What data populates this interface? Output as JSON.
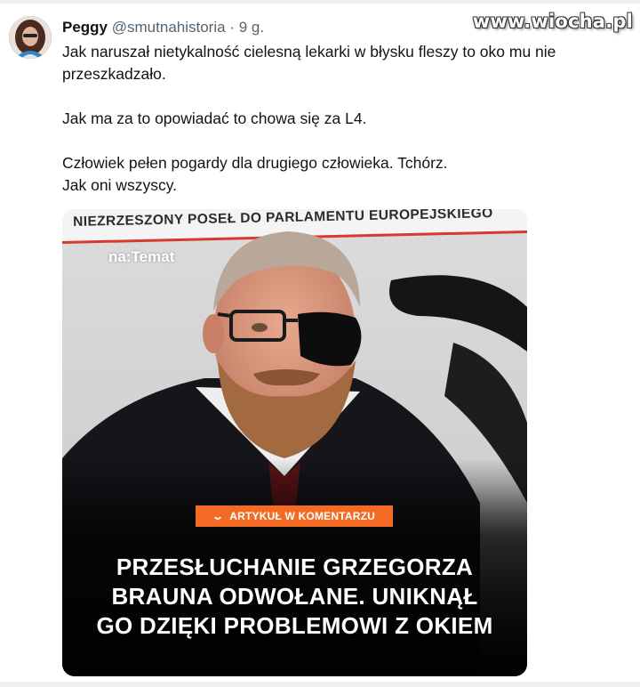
{
  "tweet": {
    "author_name": "Peggy",
    "author_handle": "@smutnahistoria",
    "separator": "·",
    "time": "9 g.",
    "paragraphs": [
      [
        "Jak naruszał nietykalność cielesną lekarki w błysku fleszy to oko mu nie",
        "przeszkadzało."
      ],
      [
        "Jak ma za to opowiadać to chowa się za L4."
      ],
      [
        "Człowiek pełen pogardy dla drugiego człowieka. Tchórz.",
        "Jak oni wszyscy."
      ]
    ]
  },
  "watermark": "www.wiocha.pl",
  "media": {
    "banner_text": "NIEZRZESZONY POSEŁ DO PARLAMENTU EUROPEJSKIEGO",
    "logo": "na:Temat",
    "cta": "ARTYKUŁ W KOMENTARZU",
    "headline_lines": [
      "PRZESŁUCHANIE GRZEGORZA",
      "BRAUNA ODWOŁANE. UNIKNĄŁ",
      "GO DZIĘKI PROBLEMOWI Z OKIEM"
    ]
  },
  "colors": {
    "cta_orange": "#f26a23",
    "banner_red": "#d93a2f",
    "handle_gray": "#536471"
  }
}
